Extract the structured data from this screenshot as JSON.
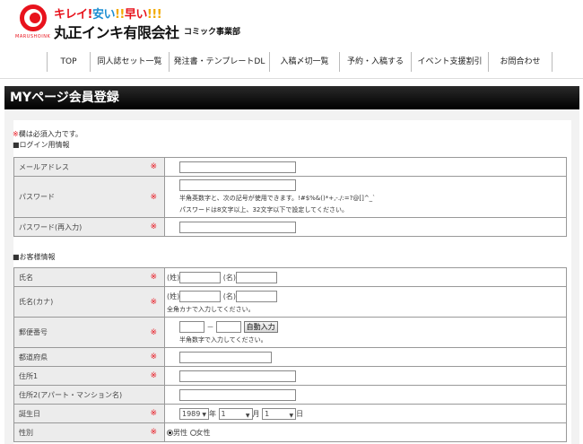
{
  "header": {
    "tagline_1": "キレイ",
    "tagline_2": "安い",
    "tagline_3": "早い",
    "bang_1": "!",
    "bang_2": "!!",
    "bang_3": "!!!",
    "company": "丸正インキ有限会社",
    "division": "コミック事業部",
    "logo_text": "MARUSHOINK"
  },
  "nav": [
    "TOP",
    "同人誌セット一覧",
    "発注書・テンプレートDL",
    "入稿〆切一覧",
    "予約・入稿する",
    "イベント支援割引",
    "お問合わせ"
  ],
  "page_title": "MYページ会員登録",
  "note": {
    "mark": "※",
    "text": "欄は必須入力です。"
  },
  "sections": {
    "login": "■ログイン用情報",
    "customer": "■お客様情報"
  },
  "required_mark": "※",
  "login_rows": {
    "email": "メールアドレス",
    "password": "パスワード",
    "password_help_1": "半角英数字と、次の記号が使用できます。!#$%&()*+,-./:=?@[]^_`",
    "password_help_2": "パスワードは8文字以上、32文字以下で設定してください。",
    "password_confirm": "パスワード(再入力)"
  },
  "customer_rows": {
    "name": "氏名",
    "name_sei": "(姓)",
    "name_mei": "(名)",
    "kana": "氏名(カナ)",
    "kana_help": "全角カナで入力してください。",
    "zip": "郵便番号",
    "zip_dash": "－",
    "zip_button": "自動入力",
    "zip_help": "半角数字で入力してください。",
    "pref": "都道府県",
    "addr1": "住所1",
    "addr2": "住所2(アパート・マンション名)",
    "birthday": "誕生日",
    "birth_year": "1989",
    "year_unit": "年",
    "birth_month": "1",
    "month_unit": "月",
    "birth_day": "1",
    "day_unit": "日",
    "gender": "性別",
    "male": "男性",
    "female": "女性"
  }
}
